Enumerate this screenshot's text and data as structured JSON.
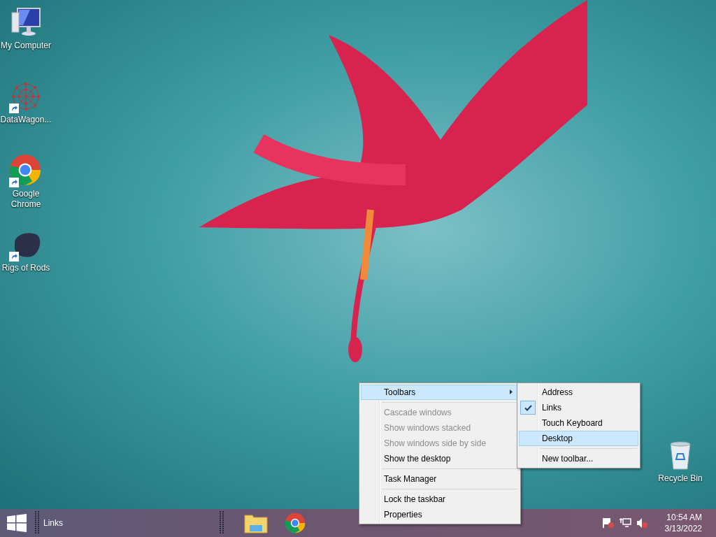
{
  "desktop_icons": [
    {
      "kind": "computer",
      "label": "My Computer",
      "shortcut": false
    },
    {
      "kind": "network",
      "label": "DataWagon...",
      "shortcut": true
    },
    {
      "kind": "chrome",
      "label": "Google Chrome",
      "shortcut": true
    },
    {
      "kind": "rods",
      "label": "Rigs of Rods",
      "shortcut": true
    }
  ],
  "recycle_bin": {
    "label": "Recycle Bin"
  },
  "context_menu": {
    "groups": [
      [
        {
          "label": "Toolbars",
          "disabled": false,
          "selected": true,
          "submenu": true
        }
      ],
      [
        {
          "label": "Cascade windows",
          "disabled": true,
          "selected": false,
          "submenu": false
        },
        {
          "label": "Show windows stacked",
          "disabled": true,
          "selected": false,
          "submenu": false
        },
        {
          "label": "Show windows side by side",
          "disabled": true,
          "selected": false,
          "submenu": false
        },
        {
          "label": "Show the desktop",
          "disabled": false,
          "selected": false,
          "submenu": false
        }
      ],
      [
        {
          "label": "Task Manager",
          "disabled": false,
          "selected": false,
          "submenu": false
        }
      ],
      [
        {
          "label": "Lock the taskbar",
          "disabled": false,
          "selected": false,
          "submenu": false
        },
        {
          "label": "Properties",
          "disabled": false,
          "selected": false,
          "submenu": false
        }
      ]
    ]
  },
  "submenu": {
    "groups": [
      [
        {
          "label": "Address",
          "checked": false,
          "selected": false
        },
        {
          "label": "Links",
          "checked": true,
          "selected": false
        },
        {
          "label": "Touch Keyboard",
          "checked": false,
          "selected": false
        },
        {
          "label": "Desktop",
          "checked": false,
          "selected": true
        }
      ],
      [
        {
          "label": "New toolbar...",
          "checked": false,
          "selected": false
        }
      ]
    ]
  },
  "taskbar": {
    "toolbar_label": "Links",
    "pinned": [
      {
        "kind": "folder"
      },
      {
        "kind": "chrome"
      }
    ],
    "clock": {
      "time": "10:54 AM",
      "date": "3/13/2022"
    }
  }
}
